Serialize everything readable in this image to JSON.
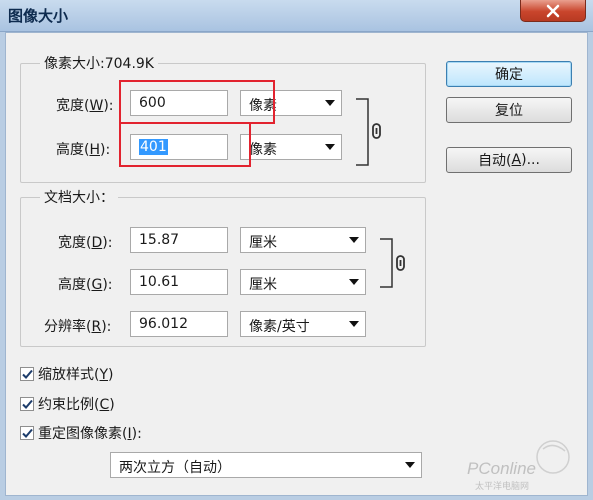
{
  "window": {
    "title": "图像大小"
  },
  "pixel_dimensions": {
    "label": "像素大小:704.9K",
    "width": {
      "label_pre": "宽度(",
      "key": "W",
      "label_post": "):",
      "value": "600",
      "unit": "像素"
    },
    "height": {
      "label_pre": "高度(",
      "key": "H",
      "label_post": "):",
      "value": "401",
      "unit": "像素"
    }
  },
  "document_size": {
    "label": "文档大小：",
    "width": {
      "label_pre": "宽度(",
      "key": "D",
      "label_post": "):",
      "value": "15.87",
      "unit": "厘米"
    },
    "height": {
      "label_pre": "高度(",
      "key": "G",
      "label_post": "):",
      "value": "10.61",
      "unit": "厘米"
    },
    "resolution": {
      "label_pre": "分辨率(",
      "key": "R",
      "label_post": "):",
      "value": "96.012",
      "unit": "像素/英寸"
    }
  },
  "buttons": {
    "ok": "确定",
    "reset": "复位",
    "auto_pre": "自动(",
    "auto_key": "A",
    "auto_post": ")..."
  },
  "options": {
    "scale_styles": {
      "label_pre": "缩放样式(",
      "key": "Y",
      "label_post": ")",
      "checked": true
    },
    "constrain": {
      "label_pre": "约束比例(",
      "key": "C",
      "label_post": ")",
      "checked": true
    },
    "resample": {
      "label_pre": "重定图像像素(",
      "key": "I",
      "label_post": "):",
      "checked": true
    }
  },
  "resample_method": "两次立方（自动）",
  "watermark": {
    "brand": "PConline",
    "sub": "太平洋电脑网"
  },
  "colors": {
    "highlight": "#e2232f",
    "default_button": "#3c7fb1",
    "selection": "#3399ff"
  }
}
